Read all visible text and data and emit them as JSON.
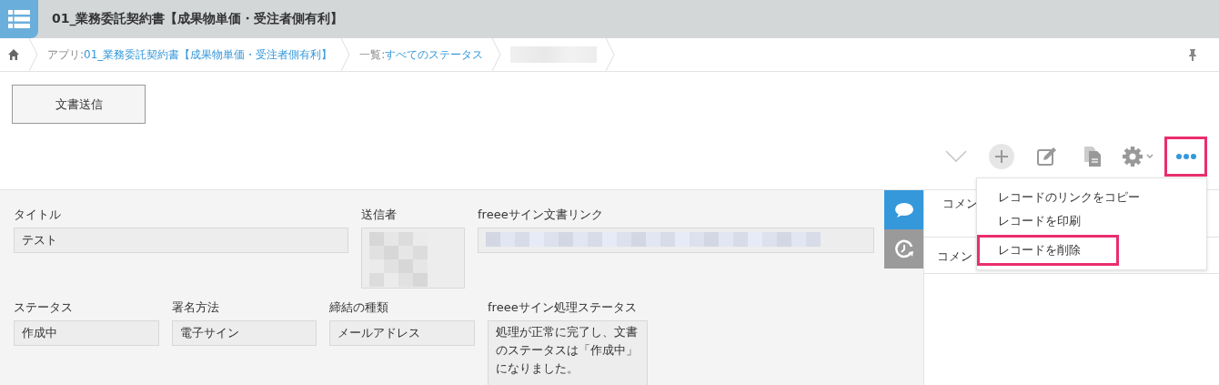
{
  "header": {
    "title": "01_業務委託契約書【成果物単価・受注者側有利】"
  },
  "breadcrumb": [
    {
      "label": "アプリ: ",
      "link": "01_業務委託契約書【成果物単価・受注者側有利】"
    },
    {
      "label": "一覧: ",
      "link": "すべてのステータス"
    }
  ],
  "action_button": "文書送信",
  "toolbar": [
    {
      "kind": "chevron",
      "highlighted": false
    },
    {
      "kind": "add",
      "highlighted": false
    },
    {
      "kind": "edit",
      "highlighted": false
    },
    {
      "kind": "duplicate",
      "highlighted": false
    },
    {
      "kind": "settings",
      "highlighted": false
    },
    {
      "kind": "more",
      "highlighted": true
    }
  ],
  "fields_row_1": [
    {
      "label": "タイトル",
      "kind": "text",
      "value": "テスト"
    },
    {
      "label": "送信者",
      "kind": "user"
    },
    {
      "label": "freeeサイン文書リンク",
      "kind": "link"
    }
  ],
  "fields_row_2": [
    {
      "label": "ステータス",
      "kind": "text",
      "value": "作成中"
    },
    {
      "label": "署名方法",
      "kind": "text",
      "value": "電子サイン"
    },
    {
      "label": "締結の種類",
      "kind": "text",
      "value": "メールアドレス"
    },
    {
      "label": "freeeサイン処理ステータス",
      "kind": "multiline",
      "value": "処理が正常に完了し、文書のステータスは「作成中」になりました。"
    }
  ],
  "side_tabs": [
    {
      "kind": "comments",
      "selected": true
    },
    {
      "kind": "history",
      "selected": false
    }
  ],
  "comments": {
    "heading": "コメン",
    "input": "コメン"
  },
  "menu": [
    {
      "label": "レコードのリンクをコピー",
      "highlighted": false
    },
    {
      "label": "レコードを印刷",
      "highlighted": false
    },
    {
      "label": "レコードを削除",
      "highlighted": true
    }
  ]
}
